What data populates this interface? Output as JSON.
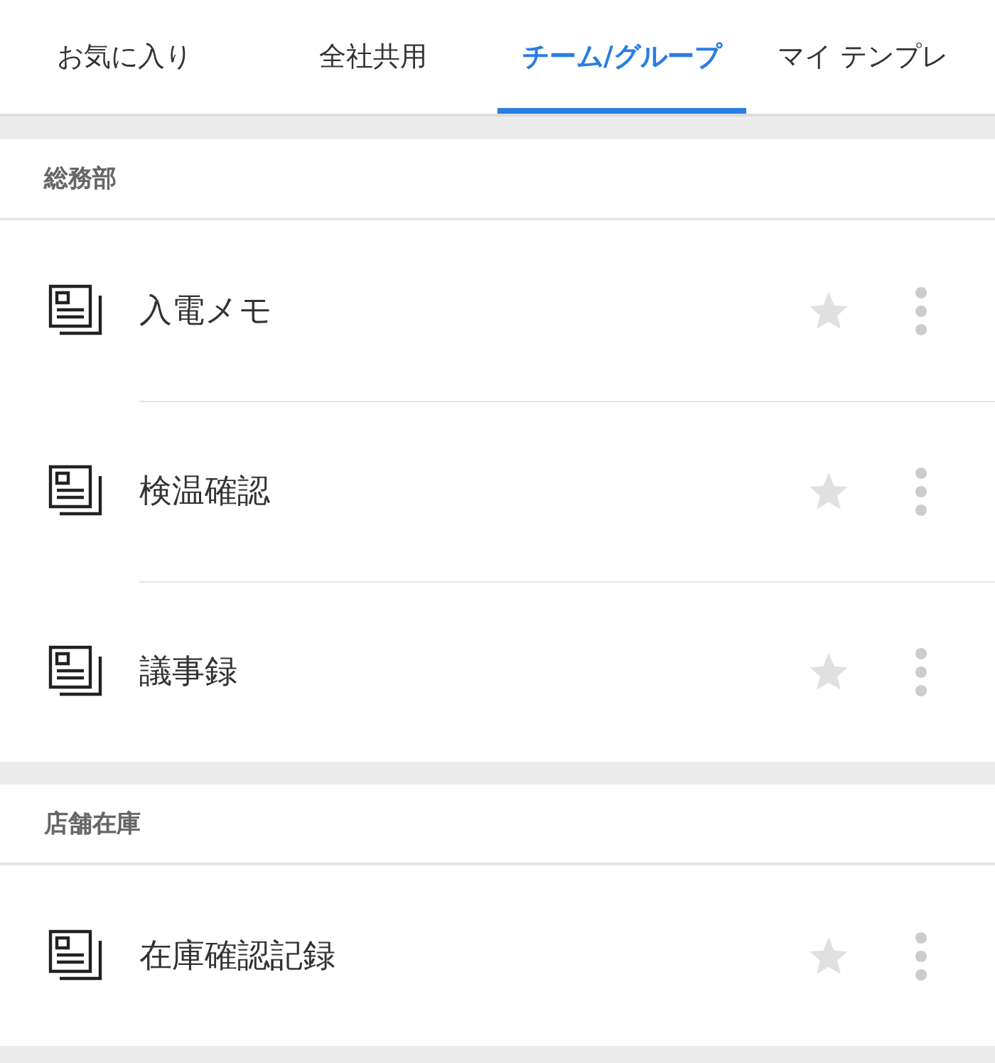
{
  "tabs": [
    {
      "label": "お気に入り",
      "selected": false
    },
    {
      "label": "全社共用",
      "selected": false
    },
    {
      "label": "チーム/グループ",
      "selected": true
    },
    {
      "label": "マイ テンプレ",
      "selected": false
    }
  ],
  "sections": [
    {
      "title": "総務部",
      "items": [
        {
          "name": "入電メモ",
          "favorite": false
        },
        {
          "name": "検温確認",
          "favorite": false
        },
        {
          "name": "議事録",
          "favorite": false
        }
      ]
    },
    {
      "title": "店舗在庫",
      "items": [
        {
          "name": "在庫確認記録",
          "favorite": false
        }
      ]
    }
  ]
}
